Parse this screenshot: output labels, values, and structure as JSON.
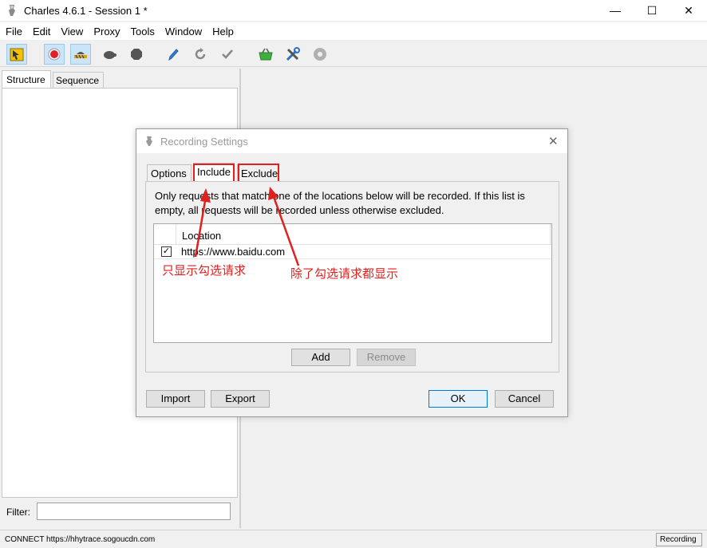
{
  "window": {
    "title": "Charles 4.6.1 - Session 1 *",
    "controls": {
      "minimize": "—",
      "maximize": "☐",
      "close": "✕"
    }
  },
  "menu": [
    "File",
    "Edit",
    "View",
    "Proxy",
    "Tools",
    "Window",
    "Help"
  ],
  "toolbar": {
    "buttons": [
      {
        "icon": "pointer-icon",
        "active": true
      },
      {
        "icon": "record-icon",
        "active": true
      },
      {
        "icon": "throttle-icon",
        "active": true
      },
      {
        "icon": "turtle-icon",
        "active": false
      },
      {
        "icon": "stop-hexagon-icon",
        "active": false
      },
      {
        "icon": "pen-icon",
        "active": false
      },
      {
        "icon": "refresh-icon",
        "active": false
      },
      {
        "icon": "check-icon",
        "active": false
      },
      {
        "icon": "basket-icon",
        "active": false
      },
      {
        "icon": "tools-icon",
        "active": false
      },
      {
        "icon": "settings-gear-icon",
        "active": false
      }
    ]
  },
  "left_panel": {
    "tabs": [
      "Structure",
      "Sequence"
    ],
    "filter_label": "Filter:",
    "filter_value": ""
  },
  "status": {
    "text": "CONNECT https://hhytrace.sogoucdn.com",
    "recording": "Recording"
  },
  "dialog": {
    "title": "Recording Settings",
    "close": "✕",
    "tabs": [
      "Options",
      "Include",
      "Exclude"
    ],
    "description": "Only requests that match one of the locations below will be recorded. If this list is empty, all requests will be recorded unless otherwise excluded.",
    "table": {
      "header": "Location",
      "rows": [
        {
          "checked": true,
          "check_mark": "✓",
          "url": "https://www.baidu.com"
        }
      ]
    },
    "buttons": {
      "add": "Add",
      "remove": "Remove",
      "import": "Import",
      "export": "Export",
      "ok": "OK",
      "cancel": "Cancel"
    }
  },
  "annotations": {
    "include_note": "只显示勾选请求",
    "exclude_note": "除了勾选请求都显示",
    "color": "#e0201e"
  }
}
